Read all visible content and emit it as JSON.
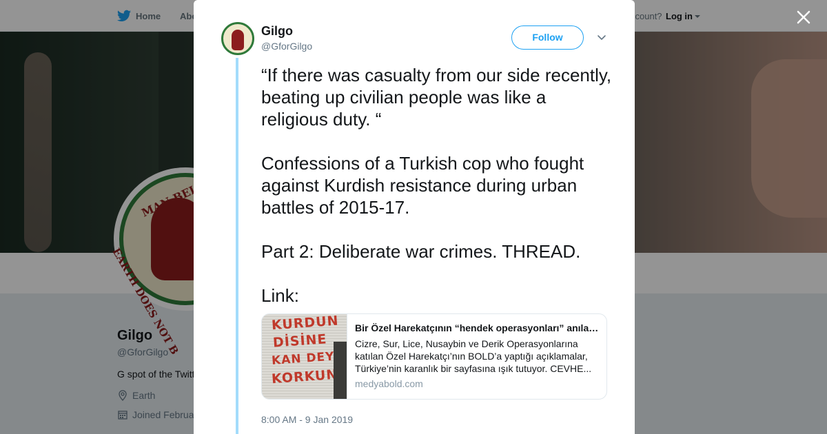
{
  "topnav": {
    "home_label": "Home",
    "about_label": "Abo",
    "account_prompt": "ccount?",
    "login_label": "Log in",
    "brand_color": "#1da1f2"
  },
  "profile": {
    "name": "Gilgo",
    "handle": "@GforGilgo",
    "bio": "G spot of the Twitt",
    "location": "Earth",
    "joined": "Joined Februa",
    "avatar_text_top": "MAN BELONGS T",
    "avatar_text_side": "EARTH DOES NOT B"
  },
  "tweet": {
    "author_name": "Gilgo",
    "author_handle": "@GforGilgo",
    "follow_label": "Follow",
    "paragraphs": [
      "“If there was casualty from our side recently, beating up civilian people was like a religious duty. “",
      "Confessions of a Turkish cop who fought against Kurdish resistance during urban battles of 2015-17.",
      "Part 2: Deliberate war crimes. THREAD.",
      "Link:"
    ],
    "timestamp": "8:00 AM - 9 Jan 2019"
  },
  "link_card": {
    "title": "Bir Özel Harekatçının “hendek operasyonları” anılarından kesitler",
    "description": "Cizre, Sur, Lice, Nusaybin ve Derik Operasyonlarına katılan Özel Harekatçı’nın BOLD’a yaptığı açıklamalar, Türkiye’nin karanlık bir sayfasına ışık tutuyor. CEVHE...",
    "domain": "medyabold.com",
    "image_graffiti": [
      "KURDUN",
      "DİSİNE",
      "KAN DEYİN",
      "KORKUN"
    ]
  },
  "colors": {
    "accent": "#1da1f2",
    "thread_line": "#a3dcfb",
    "muted_text": "#657786"
  }
}
